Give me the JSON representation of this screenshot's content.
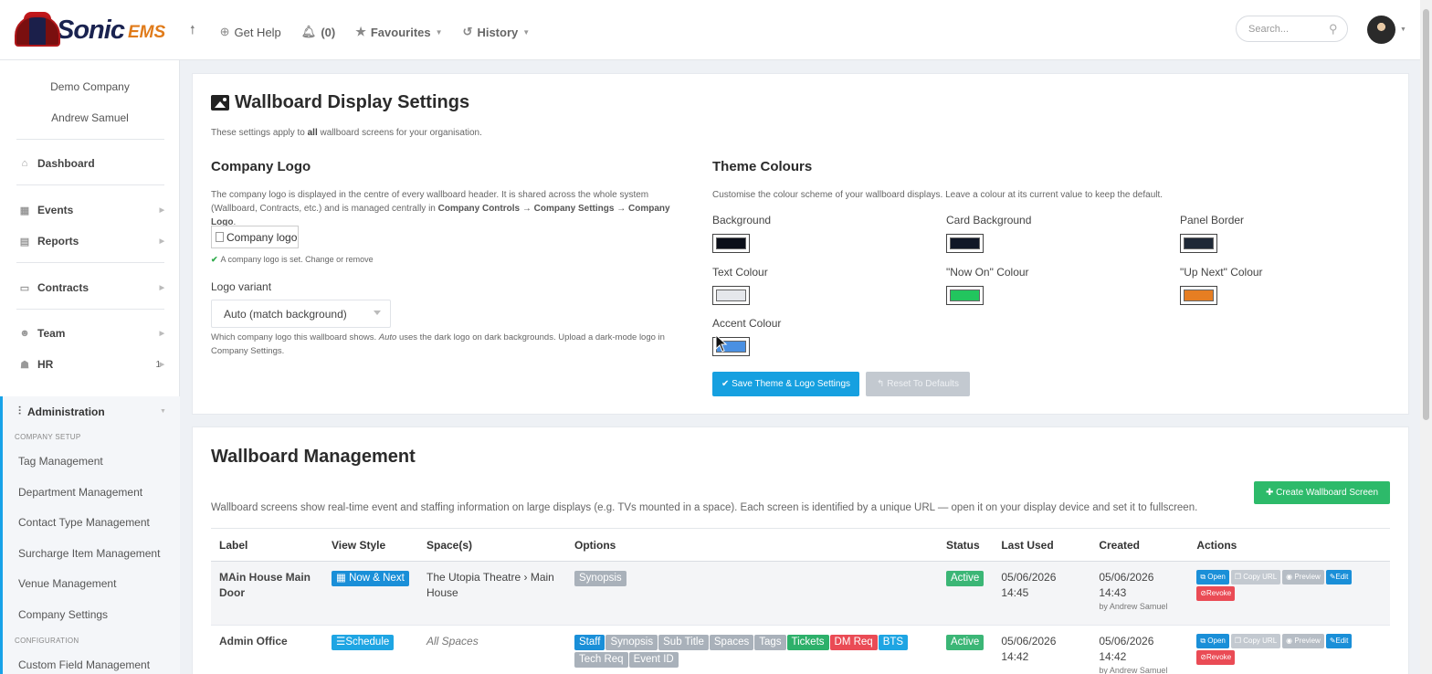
{
  "app": {
    "logo_text": "Sonic",
    "logo_suffix": "EMS"
  },
  "topnav": {
    "up_icon": "arrow-up-icon",
    "get_help": "Get Help",
    "notifications": "(0)",
    "favourites": "Favourites",
    "history": "History"
  },
  "search": {
    "placeholder": "Search..."
  },
  "sidebar": {
    "company": "Demo Company",
    "user": "Andrew Samuel",
    "items": [
      {
        "label": "Dashboard",
        "icon": "home-icon"
      },
      {
        "label": "Events",
        "icon": "calendar-icon"
      },
      {
        "label": "Reports",
        "icon": "reports-icon"
      },
      {
        "label": "Contracts",
        "icon": "contract-icon"
      },
      {
        "label": "Team",
        "icon": "team-icon"
      },
      {
        "label": "HR",
        "icon": "hr-icon",
        "badge": "1"
      }
    ],
    "admin": "Administration",
    "section_company_setup": "COMPANY SETUP",
    "sub_items": [
      "Tag Management",
      "Department Management",
      "Contact Type Management",
      "Surcharge Item Management",
      "Venue Management",
      "Company Settings"
    ],
    "section_configuration": "CONFIGURATION",
    "config_items": [
      "Custom Field Management"
    ]
  },
  "display_settings": {
    "title": "Wallboard Display Settings",
    "intro_pre": "These settings apply to ",
    "intro_bold": "all",
    "intro_post": " wallboard screens for your organisation.",
    "company_logo": {
      "title": "Company Logo",
      "desc_1": "The company logo is displayed in the centre of every wallboard header. It is shared across the whole system",
      "desc_2_pre": "(Wallboard, Contracts, etc.) and is managed centrally in ",
      "desc_2_bold": "Company Controls → Company Settings → Company Logo",
      "desc_2_post": ".",
      "img_alt": "Company logo",
      "status": "A company logo is set. Change or remove",
      "variant_label": "Logo variant",
      "variant_value": "Auto (match background)",
      "variant_help_1_pre": "Which company logo this wallboard shows. ",
      "variant_help_1_em": "Auto",
      "variant_help_1_post": " uses the dark logo on dark backgrounds. Upload a dark-mode logo in",
      "variant_help_2": "Company Settings."
    },
    "theme": {
      "title": "Theme Colours",
      "desc": "Customise the colour scheme of your wallboard displays. Leave a colour at its current value to keep the default.",
      "colours": [
        {
          "label": "Background",
          "value": "#0b0f19"
        },
        {
          "label": "Card Background",
          "value": "#111827"
        },
        {
          "label": "Panel Border",
          "value": "#1f2937"
        },
        {
          "label": "Text Colour",
          "value": "#e5e7eb"
        },
        {
          "label": "\"Now On\" Colour",
          "value": "#22c55e"
        },
        {
          "label": "\"Up Next\" Colour",
          "value": "#e67e22"
        },
        {
          "label": "Accent Colour",
          "value": "#4a90e2"
        }
      ]
    },
    "save_button": "Save Theme & Logo Settings",
    "reset_button": "Reset To Defaults"
  },
  "management": {
    "title": "Wallboard Management",
    "create_button": "Create Wallboard Screen",
    "desc": "Wallboard screens show real-time event and staffing information on large displays (e.g. TVs mounted in a space). Each screen is identified by a unique URL — open it on your display device and set it to fullscreen.",
    "columns": [
      "Label",
      "View Style",
      "Space(s)",
      "Options",
      "Status",
      "Last Used",
      "Created",
      "Actions"
    ],
    "rows": [
      {
        "label": "MAin House Main Door",
        "view_style": "Now & Next",
        "spaces": "The Utopia Theatre › Main House",
        "options": [
          {
            "text": "Synopsis",
            "color": "grey"
          }
        ],
        "status": "Active",
        "last_used_date": "05/06/2026",
        "last_used_time": "14:45",
        "created_date": "05/06/2026",
        "created_time": "14:43",
        "created_by": "by Andrew Samuel"
      },
      {
        "label": "Admin Office",
        "view_style": "Schedule",
        "spaces": "All Spaces",
        "options": [
          {
            "text": "Staff",
            "color": "blue"
          },
          {
            "text": "Synopsis",
            "color": "grey"
          },
          {
            "text": "Sub Title",
            "color": "grey"
          },
          {
            "text": "Spaces",
            "color": "grey"
          },
          {
            "text": "Tags",
            "color": "grey"
          },
          {
            "text": "Tickets",
            "color": "green"
          },
          {
            "text": "DM Req",
            "color": "red"
          },
          {
            "text": "BTS",
            "color": "lightblue"
          },
          {
            "text": "Tech Req",
            "color": "grey"
          },
          {
            "text": "Event ID",
            "color": "grey"
          }
        ],
        "status": "Active",
        "last_used_date": "05/06/2026",
        "last_used_time": "14:42",
        "created_date": "05/06/2026",
        "created_time": "14:42",
        "created_by": "by Andrew Samuel"
      }
    ],
    "actions": {
      "open": "Open",
      "copy_url": "Copy URL",
      "preview": "Preview",
      "edit": "Edit",
      "revoke": "Revoke"
    }
  }
}
